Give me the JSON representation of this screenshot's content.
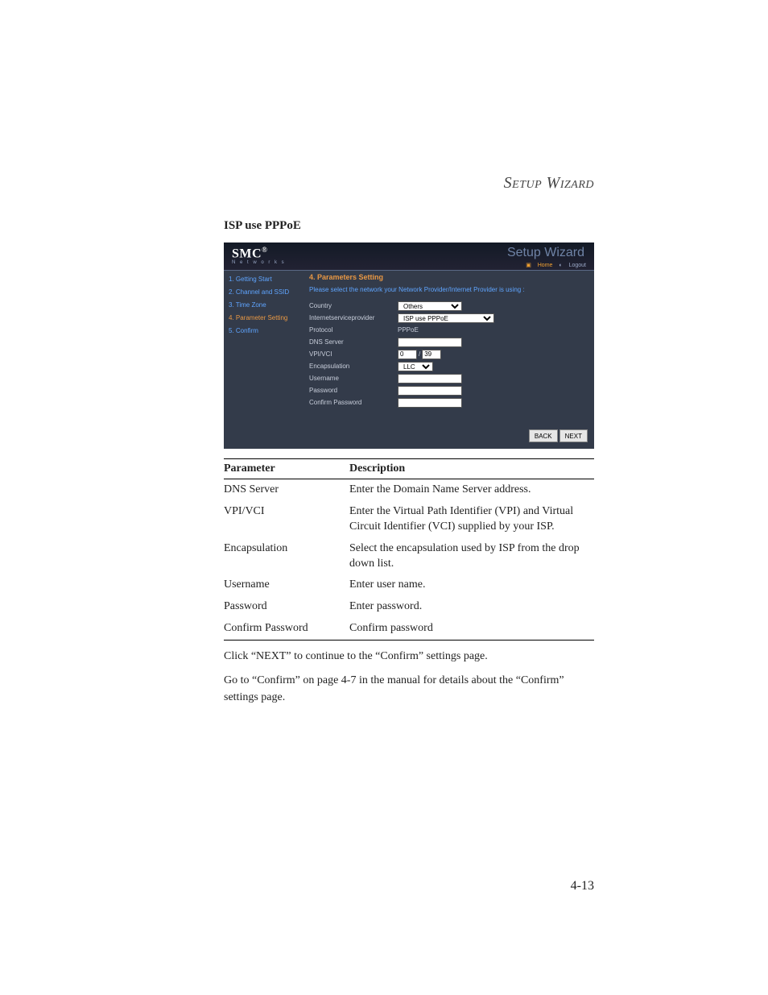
{
  "header_title": "Setup Wizard",
  "section_heading": "ISP use PPPoE",
  "screenshot": {
    "brand": "SMC",
    "brand_reg": "®",
    "brand_sub": "N e t w o r k s",
    "wizard_label": "Setup Wizard",
    "top_links": {
      "home": "Home",
      "logout": "Logout"
    },
    "side_items": [
      {
        "label": "1. Getting Start",
        "active": false
      },
      {
        "label": "2. Channel and SSID",
        "active": false
      },
      {
        "label": "3. Time Zone",
        "active": false
      },
      {
        "label": "4. Parameter Setting",
        "active": true
      },
      {
        "label": "5. Confirm",
        "active": false
      }
    ],
    "main_title": "4. Parameters Setting",
    "main_note": "Please select the network your Network Provider/Internet Provider is using :",
    "form": {
      "country_label": "Country",
      "country_value": "Others",
      "isp_label": "Internetserviceprovider",
      "isp_value": "ISP use PPPoE",
      "protocol_label": "Protocol",
      "protocol_value": "PPPoE",
      "dns_label": "DNS Server",
      "dns_value": "",
      "vpivci_label": "VPI/VCI",
      "vpi_value": "0",
      "vci_value": "39",
      "encap_label": "Encapsulation",
      "encap_value": "LLC",
      "user_label": "Username",
      "user_value": "",
      "pass_label": "Password",
      "pass_value": "",
      "confirm_label": "Confirm Password",
      "confirm_value": ""
    },
    "buttons": {
      "back": "BACK",
      "next": "NEXT"
    }
  },
  "table": {
    "col_param": "Parameter",
    "col_desc": "Description",
    "rows": [
      {
        "param": "DNS Server",
        "desc": "Enter the Domain Name Server address."
      },
      {
        "param": "VPI/VCI",
        "desc": "Enter the Virtual Path Identifier (VPI) and Virtual Circuit Identifier (VCI) supplied by your ISP."
      },
      {
        "param": "Encapsulation",
        "desc": "Select the encapsulation used by ISP from the drop down list."
      },
      {
        "param": "Username",
        "desc": "Enter user name."
      },
      {
        "param": "Password",
        "desc": "Enter password."
      },
      {
        "param": "Confirm Password",
        "desc": "Confirm password"
      }
    ]
  },
  "para1": "Click “NEXT” to continue to the “Confirm” settings page.",
  "para2": "Go to “Confirm” on page 4-7 in the manual for details about the “Confirm” settings page.",
  "page_number": "4-13"
}
